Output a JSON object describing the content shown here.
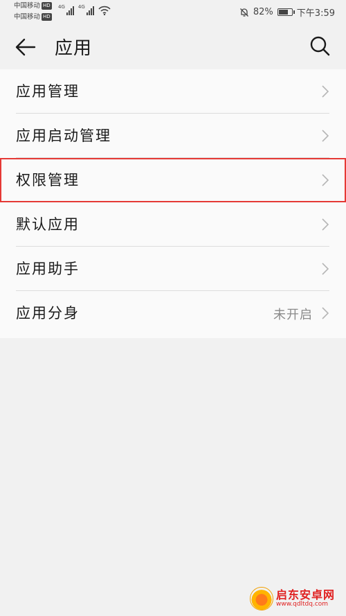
{
  "status_bar": {
    "carrier_1": "中国移动",
    "carrier_2": "中国移动",
    "hd_label": "HD",
    "network_label": "4G",
    "battery_percent_text": "82%",
    "battery_level": 0.82,
    "time": "下午3:59"
  },
  "header": {
    "title": "应用",
    "back_icon": "back-arrow-icon",
    "search_icon": "search-icon"
  },
  "menu": {
    "items": [
      {
        "label": "应用管理",
        "value": ""
      },
      {
        "label": "应用启动管理",
        "value": ""
      },
      {
        "label": "权限管理",
        "value": "",
        "highlighted": true
      },
      {
        "label": "默认应用",
        "value": ""
      },
      {
        "label": "应用助手",
        "value": ""
      },
      {
        "label": "应用分身",
        "value": "未开启"
      }
    ]
  },
  "watermark": {
    "name": "启东安卓网",
    "url": "www.qdltdq.com"
  },
  "colors": {
    "highlight_border": "#e53935",
    "watermark_red": "#e02020",
    "background": "#f1f1f1"
  }
}
